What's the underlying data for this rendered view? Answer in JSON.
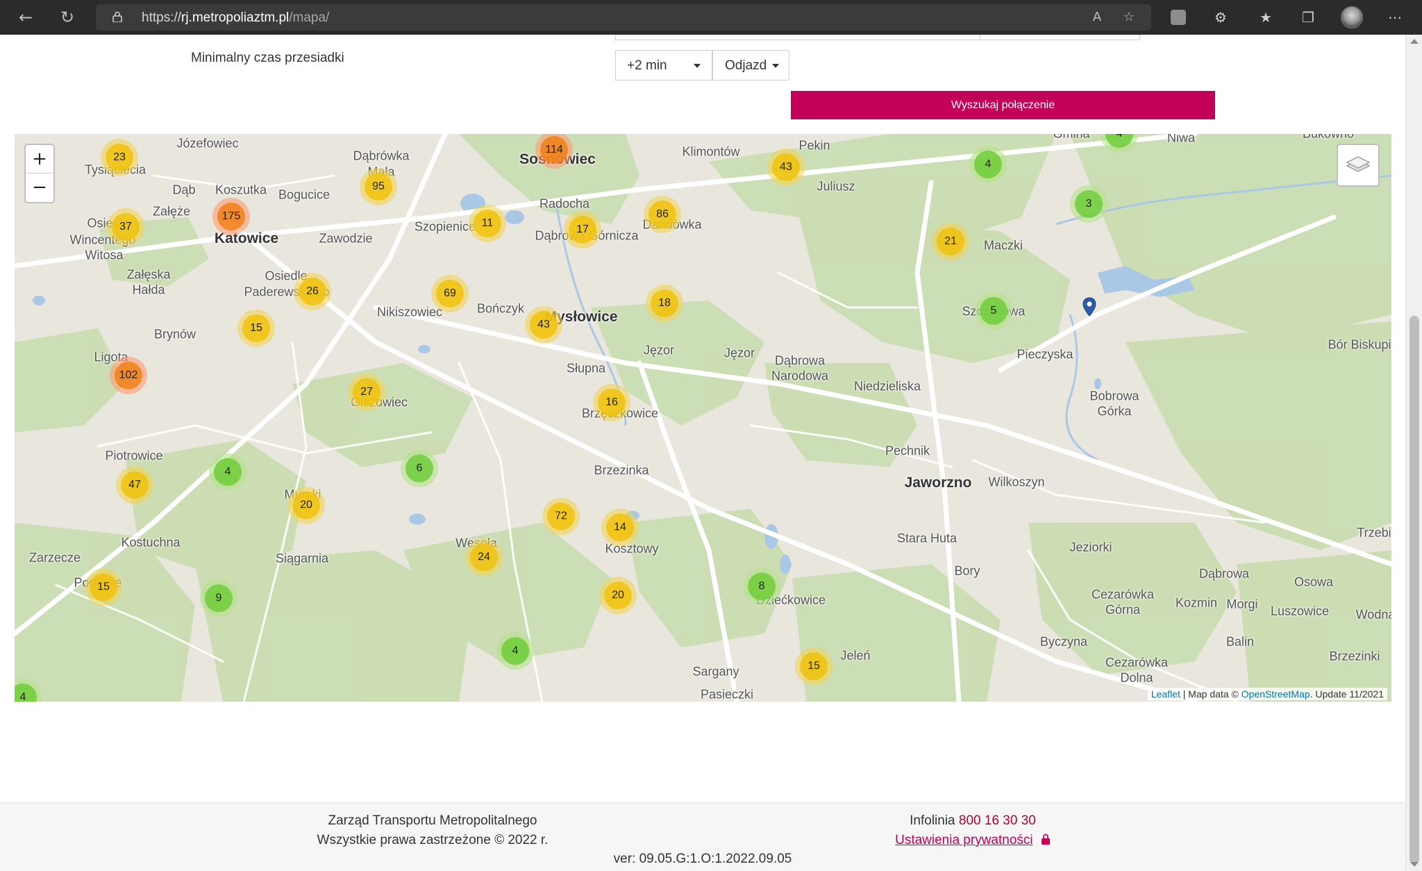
{
  "browser": {
    "url_prefix": "https://",
    "url_host": "rj.metropoliaztm.pl",
    "url_path": "/mapa/",
    "icons": [
      "back-icon",
      "refresh-icon",
      "lock-icon",
      "read-aloud-icon",
      "favorite-add-icon",
      "extension-icon",
      "extensions-icon",
      "favorites-icon",
      "collections-icon",
      "profile-avatar",
      "more-icon"
    ]
  },
  "form": {
    "transfer_label": "Minimalny czas przesiadki",
    "transfer_value": "+2 min",
    "direction_value": "Odjazd",
    "search_label": "Wyszukaj połączenie"
  },
  "map": {
    "zoom_in": "+",
    "zoom_out": "−",
    "attribution": {
      "leaflet": "Leaflet",
      "sep": " | Map data © ",
      "osm": "OpenStreetMap",
      "update": ". Update 11/2021"
    },
    "places": [
      {
        "name": "Józefowiec"
      },
      {
        "name": "Dąbrówka"
      },
      {
        "name": "Mała"
      },
      {
        "name": "Sosnowiec"
      },
      {
        "name": "Klimontów"
      },
      {
        "name": "Pekin"
      },
      {
        "name": "Niwa"
      },
      {
        "name": "Tysiąclecia"
      },
      {
        "name": "Koszutka"
      },
      {
        "name": "Bogucice"
      },
      {
        "name": "Dąb"
      },
      {
        "name": "Załęże"
      },
      {
        "name": "Juliusz"
      },
      {
        "name": "Radocha"
      },
      {
        "name": "Szopienice"
      },
      {
        "name": "Dąbrowa Górnicza"
      },
      {
        "name": "Dańdówka"
      },
      {
        "name": "Katowice"
      },
      {
        "name": "Zawodzie"
      },
      {
        "name": "Osiedle"
      },
      {
        "name": "Wincentego"
      },
      {
        "name": "Witosa"
      },
      {
        "name": "Maczki"
      },
      {
        "name": "Załęska"
      },
      {
        "name": "Hałda"
      },
      {
        "name": "Osiedle"
      },
      {
        "name": "Paderewskiego"
      },
      {
        "name": "Bończyk"
      },
      {
        "name": "Nikiszowiec"
      },
      {
        "name": "Mysłowice"
      },
      {
        "name": "Szczakowa"
      },
      {
        "name": "Brynów"
      },
      {
        "name": "Pieczyska"
      },
      {
        "name": "Bór Biskupi"
      },
      {
        "name": "Ligota"
      },
      {
        "name": "Jęzor"
      },
      {
        "name": "Jęzor"
      },
      {
        "name": "Słupna"
      },
      {
        "name": "Dąbrowa"
      },
      {
        "name": "Narodowa"
      },
      {
        "name": "Niedzieliska"
      },
      {
        "name": "Bobrowa"
      },
      {
        "name": "Górka"
      },
      {
        "name": "Giszowiec"
      },
      {
        "name": "Brzęczkowice"
      },
      {
        "name": "Piotrowice"
      },
      {
        "name": "Brzezinka"
      },
      {
        "name": "Pechnik"
      },
      {
        "name": "Jaworzno"
      },
      {
        "name": "Wilkoszyn"
      },
      {
        "name": "Murcki"
      },
      {
        "name": "Kostuchna"
      },
      {
        "name": "Stara Huta"
      },
      {
        "name": "Zarzecze"
      },
      {
        "name": "Siągarnia"
      },
      {
        "name": "Wesoła"
      },
      {
        "name": "Kosztowy"
      },
      {
        "name": "Jeziorki"
      },
      {
        "name": "Dąbrowa"
      },
      {
        "name": "Bory"
      },
      {
        "name": "Trzebinia"
      },
      {
        "name": "Podlesie"
      },
      {
        "name": "Dziećkowice"
      },
      {
        "name": "Cezarówka"
      },
      {
        "name": "Górna"
      },
      {
        "name": "Kozmin"
      },
      {
        "name": "Morgi"
      },
      {
        "name": "Osowa"
      },
      {
        "name": "Luszowice"
      },
      {
        "name": "Wodna"
      },
      {
        "name": "Byczyna"
      },
      {
        "name": "Balin"
      },
      {
        "name": "Cezarówka"
      },
      {
        "name": "Dolna"
      },
      {
        "name": "Brzezinki"
      },
      {
        "name": "Jeleń"
      },
      {
        "name": "Sargany"
      },
      {
        "name": "Pasieczki"
      },
      {
        "name": "Bukowno"
      },
      {
        "name": "Gmina"
      }
    ],
    "clusters": [
      {
        "count": "23",
        "level": "medium"
      },
      {
        "count": "114",
        "level": "large"
      },
      {
        "count": "43",
        "level": "medium"
      },
      {
        "count": "4",
        "level": "small"
      },
      {
        "count": "4",
        "level": "small"
      },
      {
        "count": "95",
        "level": "medium"
      },
      {
        "count": "175",
        "level": "large"
      },
      {
        "count": "37",
        "level": "medium"
      },
      {
        "count": "11",
        "level": "medium"
      },
      {
        "count": "17",
        "level": "medium"
      },
      {
        "count": "86",
        "level": "medium"
      },
      {
        "count": "3",
        "level": "small"
      },
      {
        "count": "21",
        "level": "medium"
      },
      {
        "count": "26",
        "level": "medium"
      },
      {
        "count": "69",
        "level": "medium"
      },
      {
        "count": "18",
        "level": "medium"
      },
      {
        "count": "5",
        "level": "small"
      },
      {
        "count": "15",
        "level": "medium"
      },
      {
        "count": "43",
        "level": "medium"
      },
      {
        "count": "102",
        "level": "large"
      },
      {
        "count": "27",
        "level": "medium"
      },
      {
        "count": "16",
        "level": "medium"
      },
      {
        "count": "4",
        "level": "small"
      },
      {
        "count": "6",
        "level": "small"
      },
      {
        "count": "47",
        "level": "medium"
      },
      {
        "count": "20",
        "level": "medium"
      },
      {
        "count": "72",
        "level": "medium"
      },
      {
        "count": "14",
        "level": "medium"
      },
      {
        "count": "24",
        "level": "medium"
      },
      {
        "count": "15",
        "level": "medium"
      },
      {
        "count": "9",
        "level": "small"
      },
      {
        "count": "8",
        "level": "small"
      },
      {
        "count": "20",
        "level": "medium"
      },
      {
        "count": "4",
        "level": "small"
      },
      {
        "count": "15",
        "level": "medium"
      },
      {
        "count": "4",
        "level": "small"
      }
    ]
  },
  "footer": {
    "org": "Zarząd Transportu Metropolitalnego",
    "rights": "Wszystkie prawa zastrzeżone © 2022 r.",
    "infolinia_label": "Infolinia ",
    "phone": "800 16 30 30",
    "privacy": "Ustawienia prywatności",
    "version": "ver: 09.05.G:1.O:1.2022.09.05"
  },
  "colors": {
    "accent": "#c3005a",
    "cluster_small": "#6ecc39",
    "cluster_medium": "#f0c20c",
    "cluster_large": "#f18017",
    "marker": "#2a5ca8"
  }
}
